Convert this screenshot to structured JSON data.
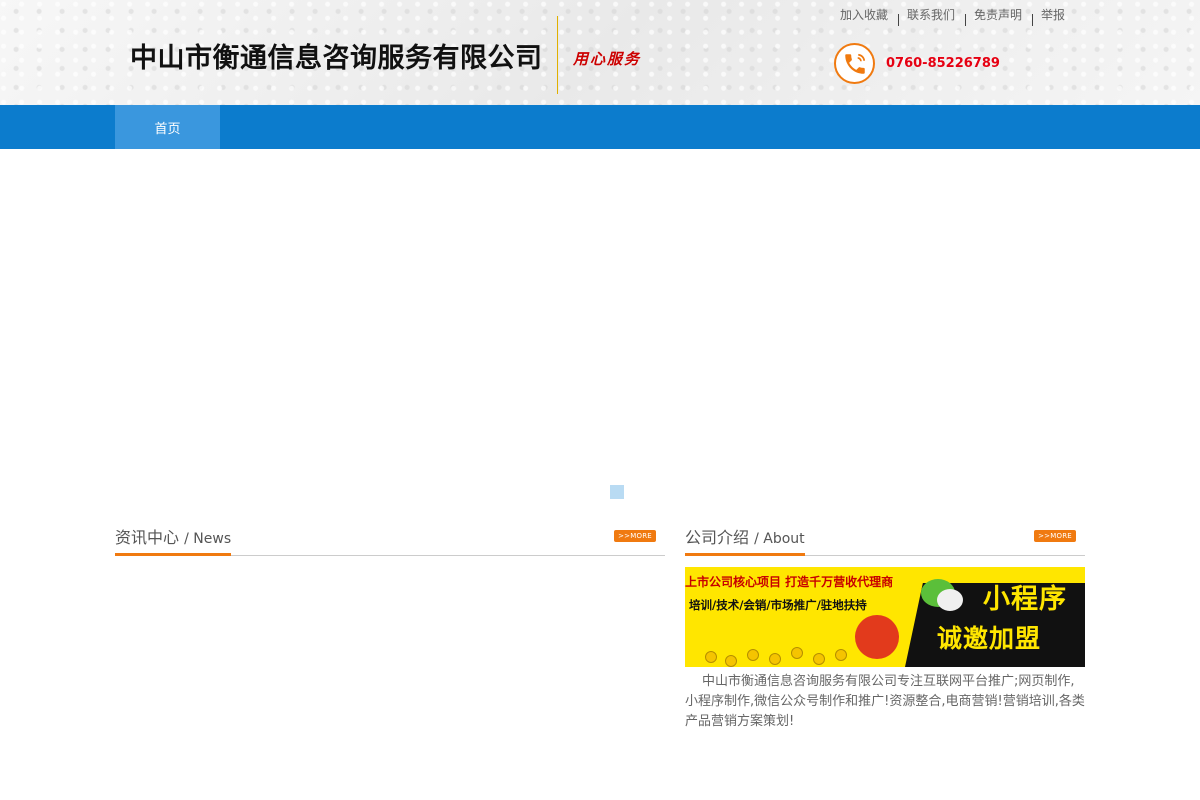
{
  "header": {
    "company_name": "中山市衡通信息咨询服务有限公司",
    "slogan": "用心服务",
    "top_links": [
      "加入收藏",
      "联系我们",
      "免责声明",
      "举报"
    ],
    "phone_icon": "phone-icon",
    "phone": "0760-85226789"
  },
  "nav": {
    "items": [
      {
        "label": "首页",
        "active": true
      }
    ]
  },
  "banner": {
    "indicator_count": 1
  },
  "news": {
    "title": "资讯中心",
    "subtitle": "/ News",
    "more_label": ">>MORE"
  },
  "about": {
    "title": "公司介绍",
    "subtitle": "/ About",
    "more_label": ">>MORE",
    "banner_line1": "上市公司核心项目 打造千万营收代理商",
    "banner_line2": "培训/技术/会销/市场推广/驻地扶持",
    "banner_big1": "小程序",
    "banner_big2": "诚邀加盟",
    "text": "中山市衡通信息咨询服务有限公司专注互联网平台推广;网页制作,小程序制作,微信公众号制作和推广!资源整合,电商营销!营销培训,各类产品营销方案策划!"
  },
  "colors": {
    "nav_bg": "#0c7ccd",
    "nav_active": "#3a97de",
    "accent": "#f07a10",
    "phone_red": "#e60012"
  }
}
